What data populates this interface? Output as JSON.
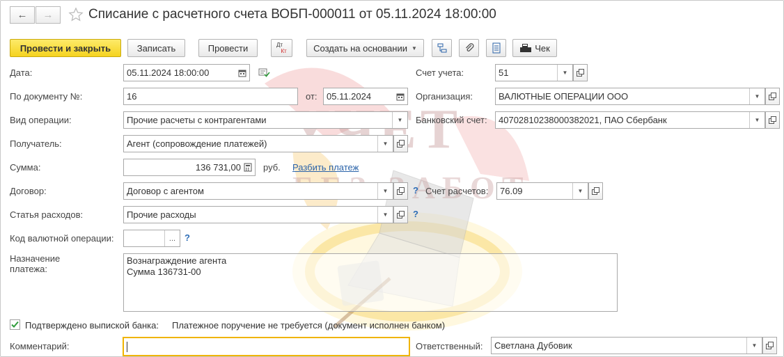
{
  "header": {
    "title": "Списание с расчетного счета ВОБП-000011 от 05.11.2024 18:00:00",
    "back_icon": "←",
    "forward_icon": "→"
  },
  "toolbar": {
    "post_and_close": "Провести и закрыть",
    "save": "Записать",
    "post": "Провести",
    "dtkt_top": "Дт",
    "dtkt_bottom": "Кт",
    "create_based_on": "Создать на основании",
    "receipt": "Чек"
  },
  "watermark": {
    "line1": "УЧЕТ",
    "line2": "БЕЗ ЗАБОТ"
  },
  "form": {
    "date": {
      "label": "Дата:",
      "value": "05.11.2024 18:00:00"
    },
    "doc_number": {
      "label": "По документу №:",
      "value": "16",
      "from_label": "от:",
      "from_value": "05.11.2024"
    },
    "operation_type": {
      "label": "Вид операции:",
      "value": "Прочие расчеты с контрагентами"
    },
    "recipient": {
      "label": "Получатель:",
      "value": "Агент (сопровождение платежей)"
    },
    "amount": {
      "label": "Сумма:",
      "value": "136 731,00",
      "currency": "руб.",
      "split_link": "Разбить платеж"
    },
    "contract": {
      "label": "Договор:",
      "value": "Договор с агентом",
      "help": "?"
    },
    "settlement_account": {
      "label": "Счет расчетов:",
      "value": "76.09"
    },
    "expense_item": {
      "label": "Статья расходов:",
      "value": "Прочие расходы",
      "help": "?"
    },
    "currency_op_code": {
      "label": "Код валютной операции:",
      "value": "",
      "help": "?",
      "choose": "..."
    },
    "purpose": {
      "label": "Назначение\nплатежа:",
      "value": "Вознаграждение агента\nСумма 136731-00"
    },
    "account": {
      "label": "Счет учета:",
      "value": "51"
    },
    "organization": {
      "label": "Организация:",
      "value": "ВАЛЮТНЫЕ ОПЕРАЦИИ ООО"
    },
    "bank_account": {
      "label": "Банковский счет:",
      "value": "40702810238000382021, ПАО Сбербанк"
    },
    "confirmed": {
      "label": "Подтверждено выпиской банка:",
      "checked": true
    },
    "payment_order_note": "Платежное поручение не требуется (документ исполнен банком)",
    "comment": {
      "label": "Комментарий:",
      "value": ""
    },
    "responsible": {
      "label": "Ответственный:",
      "value": "Светлана Дубовик"
    }
  },
  "colors": {
    "primary_button": "#f5d31f",
    "link": "#2a63a9",
    "help": "#2d6db6",
    "focus_border": "#f0b400"
  }
}
